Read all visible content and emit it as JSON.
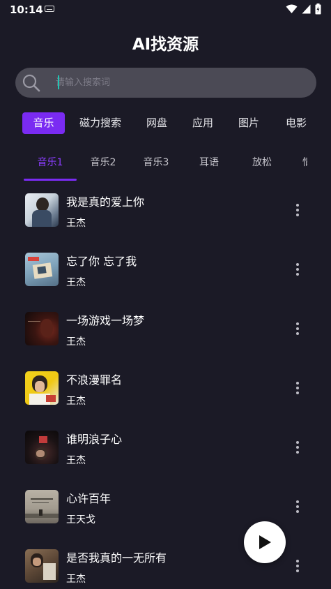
{
  "status_bar": {
    "time": "10:14"
  },
  "header": {
    "title": "AI找资源"
  },
  "search": {
    "placeholder": "请输入搜索词",
    "value": ""
  },
  "categories": [
    {
      "label": "音乐",
      "active": true
    },
    {
      "label": "磁力搜索",
      "active": false
    },
    {
      "label": "网盘",
      "active": false
    },
    {
      "label": "应用",
      "active": false
    },
    {
      "label": "图片",
      "active": false
    },
    {
      "label": "电影",
      "active": false
    }
  ],
  "tabs": [
    {
      "label": "音乐1",
      "active": true
    },
    {
      "label": "音乐2",
      "active": false
    },
    {
      "label": "音乐3",
      "active": false
    },
    {
      "label": "耳语",
      "active": false
    },
    {
      "label": "放松",
      "active": false
    },
    {
      "label": "情",
      "active": false
    }
  ],
  "songs": [
    {
      "title": "我是真的爱上你",
      "artist": "王杰"
    },
    {
      "title": "忘了你 忘了我",
      "artist": "王杰"
    },
    {
      "title": "一场游戏一场梦",
      "artist": "王杰"
    },
    {
      "title": "不浪漫罪名",
      "artist": "王杰"
    },
    {
      "title": "谁明浪子心",
      "artist": "王杰"
    },
    {
      "title": "心许百年",
      "artist": "王天戈"
    },
    {
      "title": "是否我真的一无所有",
      "artist": "王杰"
    }
  ],
  "colors": {
    "background": "#1b1a26",
    "accent": "#7a2bf2",
    "search_bg": "#4b4a55"
  },
  "icons": {
    "search": "search-icon",
    "more": "more-vertical-icon",
    "play": "play-icon"
  }
}
